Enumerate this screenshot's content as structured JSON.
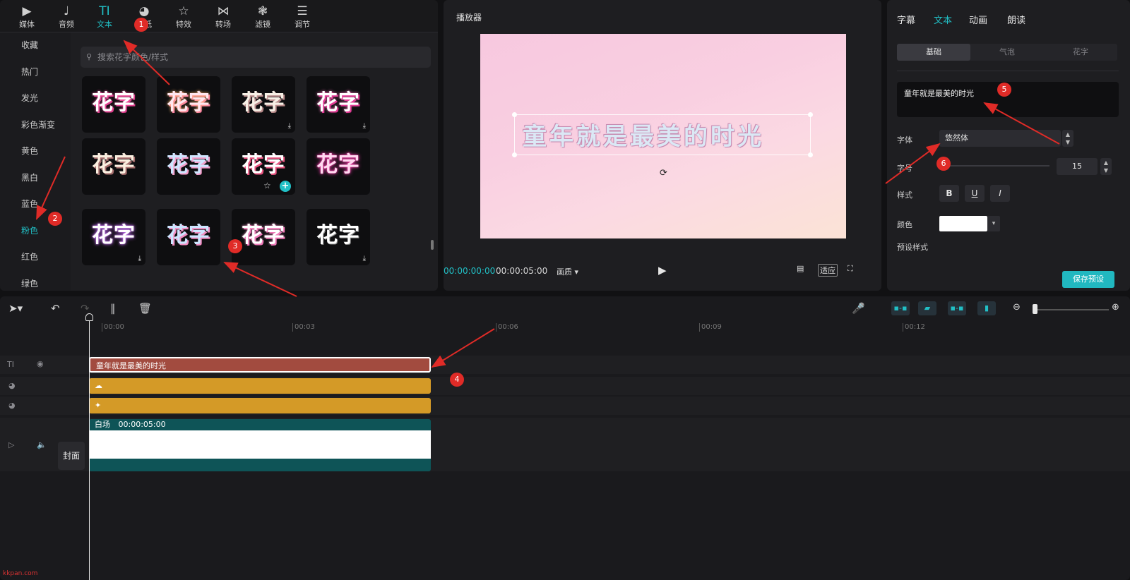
{
  "toolbar": {
    "tools": [
      {
        "label": "媒体",
        "icon": "media-icon"
      },
      {
        "label": "音频",
        "icon": "audio-icon"
      },
      {
        "label": "文本",
        "icon": "text-icon",
        "glyph": "TI"
      },
      {
        "label": "贴纸",
        "icon": "sticker-icon"
      },
      {
        "label": "特效",
        "icon": "effects-icon"
      },
      {
        "label": "转场",
        "icon": "transition-icon"
      },
      {
        "label": "滤镜",
        "icon": "filter-icon"
      },
      {
        "label": "调节",
        "icon": "adjust-icon"
      }
    ]
  },
  "categories": [
    "收藏",
    "热门",
    "发光",
    "彩色渐变",
    "黄色",
    "黑白",
    "蓝色",
    "粉色",
    "红色",
    "绿色"
  ],
  "search": {
    "placeholder": "搜索花字颜色/样式"
  },
  "preset_tile_text": "花字",
  "player": {
    "title": "播放器",
    "canvas_text": "童年就是最美的时光",
    "current_time": "00:00:00:00",
    "total_time": "00:00:05:00",
    "quality_label": "画质",
    "fit_label": "适应"
  },
  "props": {
    "tabs": [
      "字幕",
      "文本",
      "动画",
      "朗读"
    ],
    "subtabs": [
      "基础",
      "气泡",
      "花字"
    ],
    "text_value": "童年就是最美的时光",
    "font_label": "字体",
    "font_value": "悠然体",
    "size_label": "字号",
    "size_value": "15",
    "style_label": "样式",
    "style_buttons": [
      "B",
      "U",
      "I"
    ],
    "color_label": "颜色",
    "color_value": "#ffffff",
    "preset_label": "预设样式",
    "save_label": "保存预设"
  },
  "timeline": {
    "ruler": [
      "00:00",
      "00:03",
      "00:06",
      "00:09",
      "00:12"
    ],
    "text_clip": "童年就是最美的时光",
    "main_clip_label": "白场",
    "main_clip_duration": "00:00:05:00",
    "cover_label": "封面"
  },
  "annotations": [
    "1",
    "2",
    "3",
    "4",
    "5",
    "6"
  ],
  "watermark": "kkpan.com"
}
